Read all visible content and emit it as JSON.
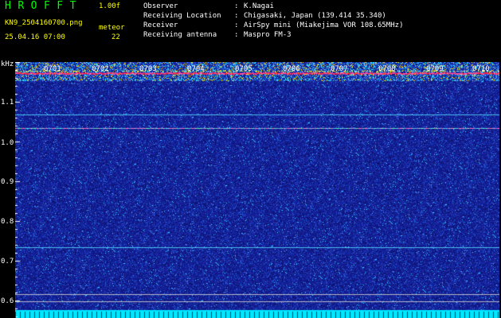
{
  "header": {
    "app_name": "HROFFT",
    "version": "1.00f",
    "filename": "KN9_2504160700.png",
    "meteor_label": "meteor",
    "datetime": "25.04.16 07:00",
    "meteor_count": "22",
    "info": [
      {
        "label": "Observer",
        "value": "K.Nagai"
      },
      {
        "label": "Receiving Location",
        "value": "Chigasaki, Japan (139.414 35.340)"
      },
      {
        "label": "Receiver",
        "value": "AirSpy mini (Miakejima VOR 108.65MHz)"
      },
      {
        "label": "Receiving antenna",
        "value": "Maspro FM-3"
      }
    ],
    "separator": ":"
  },
  "axis": {
    "y_unit": "kHz",
    "y_ticks": [
      "1.1",
      "1.0",
      "0.9",
      "0.8",
      "0.7",
      "0.6"
    ],
    "x_ticks": [
      "0701",
      "0702",
      "0703",
      "0704",
      "0705",
      "0706",
      "0707",
      "0708",
      "0709",
      "0710"
    ]
  },
  "colors": {
    "background": "#1a2aa0",
    "header_yellow": "#ffff00",
    "title_green": "#00ff00",
    "signal_red": "#ff2040",
    "cyan": "#00e8ff"
  }
}
